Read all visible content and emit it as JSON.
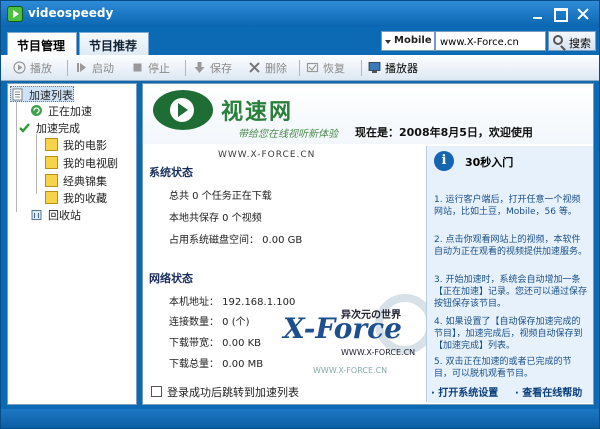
{
  "window": {
    "title": "videospeedy"
  },
  "tabs": [
    {
      "label": "节目管理",
      "active": true
    },
    {
      "label": "节目推荐",
      "active": false
    }
  ],
  "search": {
    "type": "Mobile",
    "value": "www.X-Force.cn",
    "button": "搜索"
  },
  "toolbar": {
    "play": "播放",
    "start": "启动",
    "stop": "停止",
    "save": "保存",
    "delete": "删除",
    "restore": "恢复",
    "player": "播放器"
  },
  "tree": {
    "root": "加速列表",
    "accelerating": "正在加速",
    "done": "加速完成",
    "children": [
      "我的电影",
      "我的电视剧",
      "经典锦集",
      "我的收藏"
    ],
    "recycle": "回收站"
  },
  "banner": {
    "brand": "视速网",
    "slogan": "带给您在线视听新体验",
    "date": "现在是：2008年8月5日，欢迎使用",
    "watermark": "WWW.X-FORCE.CN"
  },
  "system": {
    "title": "系统状态",
    "tasks": "总共 0 个任务正在下载",
    "saved": "本地共保存 0 个视频",
    "space": "占用系统磁盘空间： 0.00 GB"
  },
  "network": {
    "title": "网络状态",
    "ip": "本机地址： 192.168.1.100",
    "connections": "连接数量： 0 (个)",
    "bandwidth": "下载带宽： 0.00 KB",
    "total": "下载总量： 0.00 MB"
  },
  "options": {
    "auto_jump": "登录成功后跳转到加速列表"
  },
  "help": {
    "title": "30秒入门",
    "p1": "1. 运行客户端后，打开任意一个视频网站，比如土豆，Mobile，56 等。",
    "p2": "2. 点击你观看网站上的视频，本软件自动为正在观看的视频提供加速服务。",
    "p3": "3. 开始加速时，系统会自动增加一条【正在加速】记录。您还可以通过保存按钮保存该节目。",
    "p4": "4. 如果设置了【自动保存加速完成的节目】，加速完成后，视频自动保存到【加速完成】列表。",
    "p5": "5. 双击正在加速的或者已完成的节目，可以脱机观看节目。",
    "link1": "· 打开系统设置",
    "link2": "· 查看在线帮助"
  },
  "watermark": {
    "big": "X-Force",
    "cn": "异次元の世界",
    "url": "WWW.X-FORCE.CN",
    "url2": "WWW.X-FORCE.CN"
  }
}
